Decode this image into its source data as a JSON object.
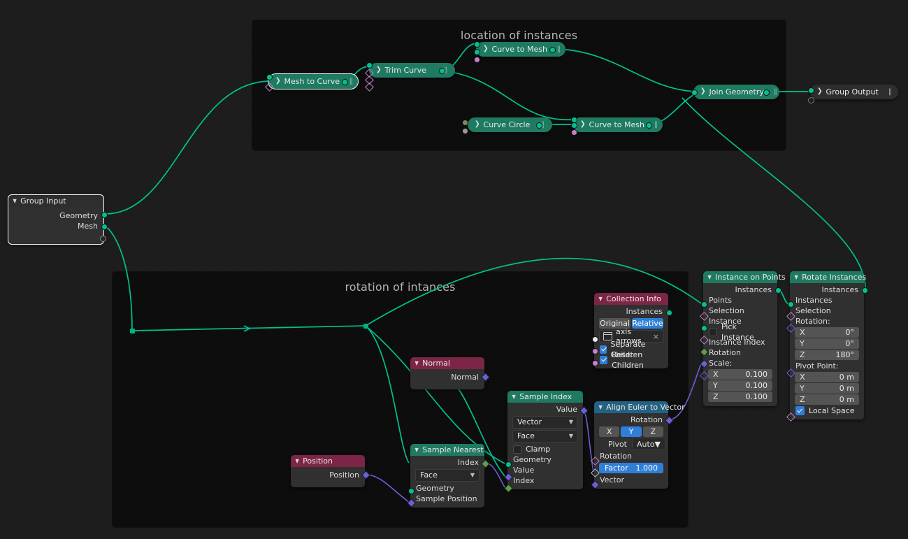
{
  "editor": {
    "name": "Blender Geometry Node Editor"
  },
  "frames": [
    {
      "label": "location of instances"
    },
    {
      "label": "rotation of intances"
    }
  ],
  "colors": {
    "geometry_header": "#1f7a62",
    "input_header": "#7c2546",
    "vector_header": "#246283",
    "accent_blue": "#2f7fd8",
    "link_geometry": "#00c28f",
    "link_field": "#6b5fd8",
    "node_body": "#303030",
    "canvas_bg": "#1d1d1d",
    "frame_bg": "#0d0d0d"
  },
  "nodes": {
    "group_input": {
      "title": "Group Input",
      "outputs": [
        "Geometry",
        "Mesh",
        ""
      ]
    },
    "mesh_to_curve": {
      "title": "Mesh to Curve",
      "grip": "‖"
    },
    "trim_curve": {
      "title": "Trim Curve",
      "grip": "‖"
    },
    "curve_to_mesh_top": {
      "title": "Curve to Mesh",
      "grip": "‖"
    },
    "curve_circle": {
      "title": "Curve Circle",
      "grip": "‖"
    },
    "curve_to_mesh_bottom": {
      "title": "Curve to Mesh",
      "grip": "‖"
    },
    "join_geometry": {
      "title": "Join Geometry",
      "grip": "‖"
    },
    "group_output": {
      "title": "Group Output",
      "grip": "‖"
    },
    "instance_on_points": {
      "title": "Instance on Points",
      "output": "Instances",
      "inputs": [
        "Points",
        "Selection",
        "Instance"
      ],
      "pick_instance": {
        "label": "Pick Instance",
        "checked": false
      },
      "instance_index": "Instance Index",
      "rotation": "Rotation",
      "scale_label": "Scale:",
      "scale": [
        {
          "axis": "X",
          "value": "0.100"
        },
        {
          "axis": "Y",
          "value": "0.100"
        },
        {
          "axis": "Z",
          "value": "0.100"
        }
      ]
    },
    "rotate_instances": {
      "title": "Rotate Instances",
      "output": "Instances",
      "inputs": [
        "Instances",
        "Selection"
      ],
      "rotation_label": "Rotation:",
      "rotation": [
        {
          "axis": "X",
          "value": "0°"
        },
        {
          "axis": "Y",
          "value": "0°"
        },
        {
          "axis": "Z",
          "value": "180°"
        }
      ],
      "pivot_label": "Pivot Point:",
      "pivot": [
        {
          "axis": "X",
          "value": "0 m"
        },
        {
          "axis": "Y",
          "value": "0 m"
        },
        {
          "axis": "Z",
          "value": "0 m"
        }
      ],
      "local_space": {
        "label": "Local Space",
        "checked": true
      }
    },
    "collection_info": {
      "title": "Collection Info",
      "output": "Instances",
      "transform_space": {
        "options": [
          "Original",
          "Relative"
        ],
        "selected": "Relative"
      },
      "collection": "axis arrows",
      "clear_icon": "×",
      "separate_children": {
        "label": "Separate Children",
        "checked": true
      },
      "reset_children": {
        "label": "Reset Children",
        "checked": true
      }
    },
    "align_euler_to_vector": {
      "title": "Align Euler to Vector",
      "output": "Rotation",
      "axis": {
        "options": [
          "X",
          "Y",
          "Z"
        ],
        "selected": "Y"
      },
      "pivot_label": "Pivot",
      "pivot_value": "Auto",
      "rotation_input": "Rotation",
      "factor": {
        "label": "Factor",
        "value": "1.000"
      },
      "vector_input": "Vector"
    },
    "sample_index": {
      "title": "Sample Index",
      "output": "Value",
      "data_type": "Vector",
      "domain": "Face",
      "clamp": {
        "label": "Clamp",
        "checked": false
      },
      "inputs": [
        "Geometry",
        "Value",
        "Index"
      ]
    },
    "sample_nearest": {
      "title": "Sample Nearest",
      "output": "Index",
      "domain": "Face",
      "inputs": [
        "Geometry",
        "Sample Position"
      ]
    },
    "normal": {
      "title": "Normal",
      "output": "Normal"
    },
    "position": {
      "title": "Position",
      "output": "Position"
    }
  }
}
